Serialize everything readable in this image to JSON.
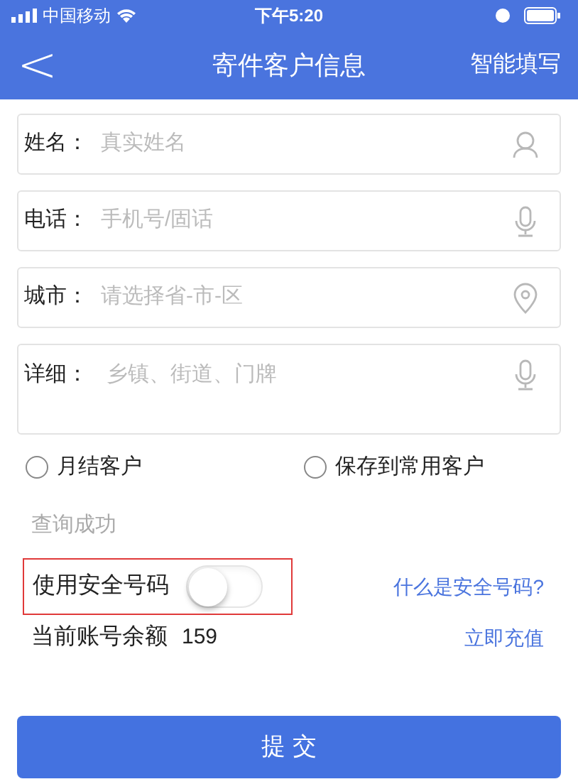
{
  "status_bar": {
    "carrier": "中国移动",
    "time": "下午5:20"
  },
  "nav": {
    "back": "<",
    "title": "寄件客户信息",
    "action": "智能填写"
  },
  "fields": [
    {
      "label": "姓名：",
      "placeholder": "真实姓名",
      "kind": "person",
      "multiline": false
    },
    {
      "label": "电话：",
      "placeholder": "手机号/固话",
      "kind": "mic",
      "multiline": false
    },
    {
      "label": "城市：",
      "placeholder": "请选择省-市-区",
      "kind": "location",
      "multiline": false
    },
    {
      "label": "详细：",
      "placeholder": "乡镇、街道、门牌",
      "kind": "mic",
      "multiline": true
    }
  ],
  "options": [
    {
      "label": "月结客户",
      "selected": false
    },
    {
      "label": "保存到常用客户",
      "selected": false
    }
  ],
  "status_message": "查询成功",
  "secure_number": {
    "label": "使用安全号码",
    "on": false,
    "highlighted": true,
    "help_link": "什么是安全号码?"
  },
  "balance": {
    "label": "当前账号余额",
    "value": "159",
    "recharge_link": "立即充值"
  },
  "submit": "提 交"
}
